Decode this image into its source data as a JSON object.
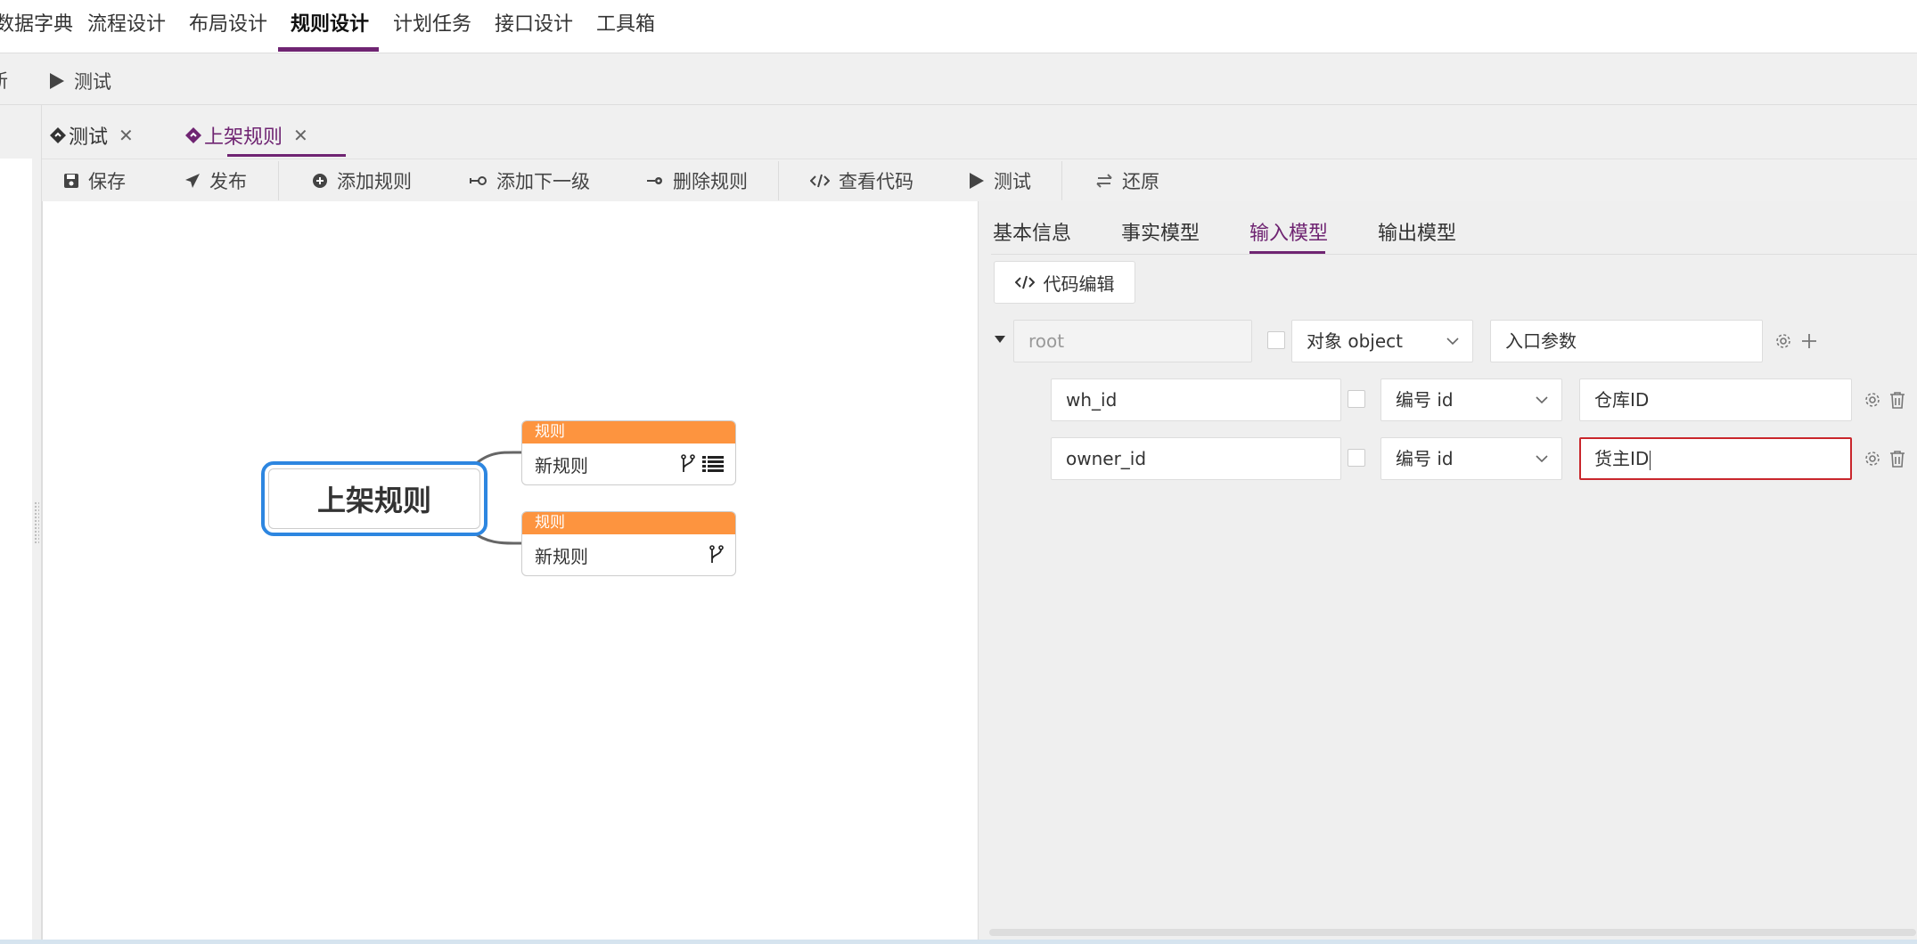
{
  "nav": {
    "items": [
      "数据字典",
      "流程设计",
      "布局设计",
      "规则设计",
      "计划任务",
      "接口设计",
      "工具箱"
    ],
    "active": "规则设计"
  },
  "toolbar1": {
    "cut_label": "新",
    "test_label": "测试"
  },
  "tabs": [
    {
      "label": "测试"
    },
    {
      "label": "上架规则"
    }
  ],
  "toolbar": {
    "save": "保存",
    "publish": "发布",
    "add_rule": "添加规则",
    "add_child": "添加下一级",
    "delete_rule": "删除规则",
    "view_code": "查看代码",
    "test": "测试",
    "restore": "还原"
  },
  "mindmap": {
    "central": "上架规则",
    "rules": [
      {
        "header": "规则",
        "name": "新规则",
        "icons": [
          "branch-icon",
          "list-icon"
        ]
      },
      {
        "header": "规则",
        "name": "新规则",
        "icons": [
          "branch-icon"
        ]
      }
    ]
  },
  "panel": {
    "tabs": [
      "基本信息",
      "事实模型",
      "输入模型",
      "输出模型"
    ],
    "active_tab": "输入模型",
    "code_edit": "代码编辑",
    "rows": [
      {
        "name": "root",
        "type": "对象 object",
        "desc": "入口参数"
      },
      {
        "name": "wh_id",
        "type": "编号 id",
        "desc": "仓库ID"
      },
      {
        "name": "owner_id",
        "type": "编号 id",
        "desc": "货主ID"
      }
    ]
  },
  "colors": {
    "accent": "#6f2472",
    "rule_header": "#fd943f",
    "central_border": "#2d86e0",
    "error_border": "#c9262c"
  }
}
